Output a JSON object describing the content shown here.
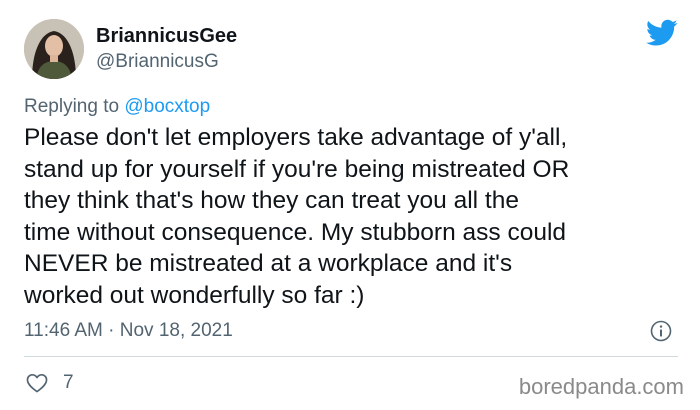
{
  "author": {
    "display_name": "BriannicusGee",
    "handle": "@BriannicusG",
    "avatar_icon": "profile-photo"
  },
  "reply": {
    "prefix": "Replying to ",
    "mention": "@bocxtop"
  },
  "tweet": {
    "lines": [
      "Please don't let employers take advantage of y'all,",
      "stand up for yourself if you're being mistreated OR",
      "they think that's how they can treat you all the",
      "time without consequence. My stubborn ass could",
      "NEVER be mistreated at a workplace and it's",
      "worked out wonderfully so far :)"
    ],
    "timestamp": "11:46 AM · Nov 18, 2021"
  },
  "engagement": {
    "like_count": "7"
  },
  "watermark": "boredpanda.com",
  "colors": {
    "twitter_blue": "#1d9bf0",
    "secondary_text": "#536471",
    "primary_text": "#0f1419"
  },
  "icons": {
    "brand": "twitter-bird-icon",
    "info": "info-icon",
    "like": "heart-icon"
  }
}
